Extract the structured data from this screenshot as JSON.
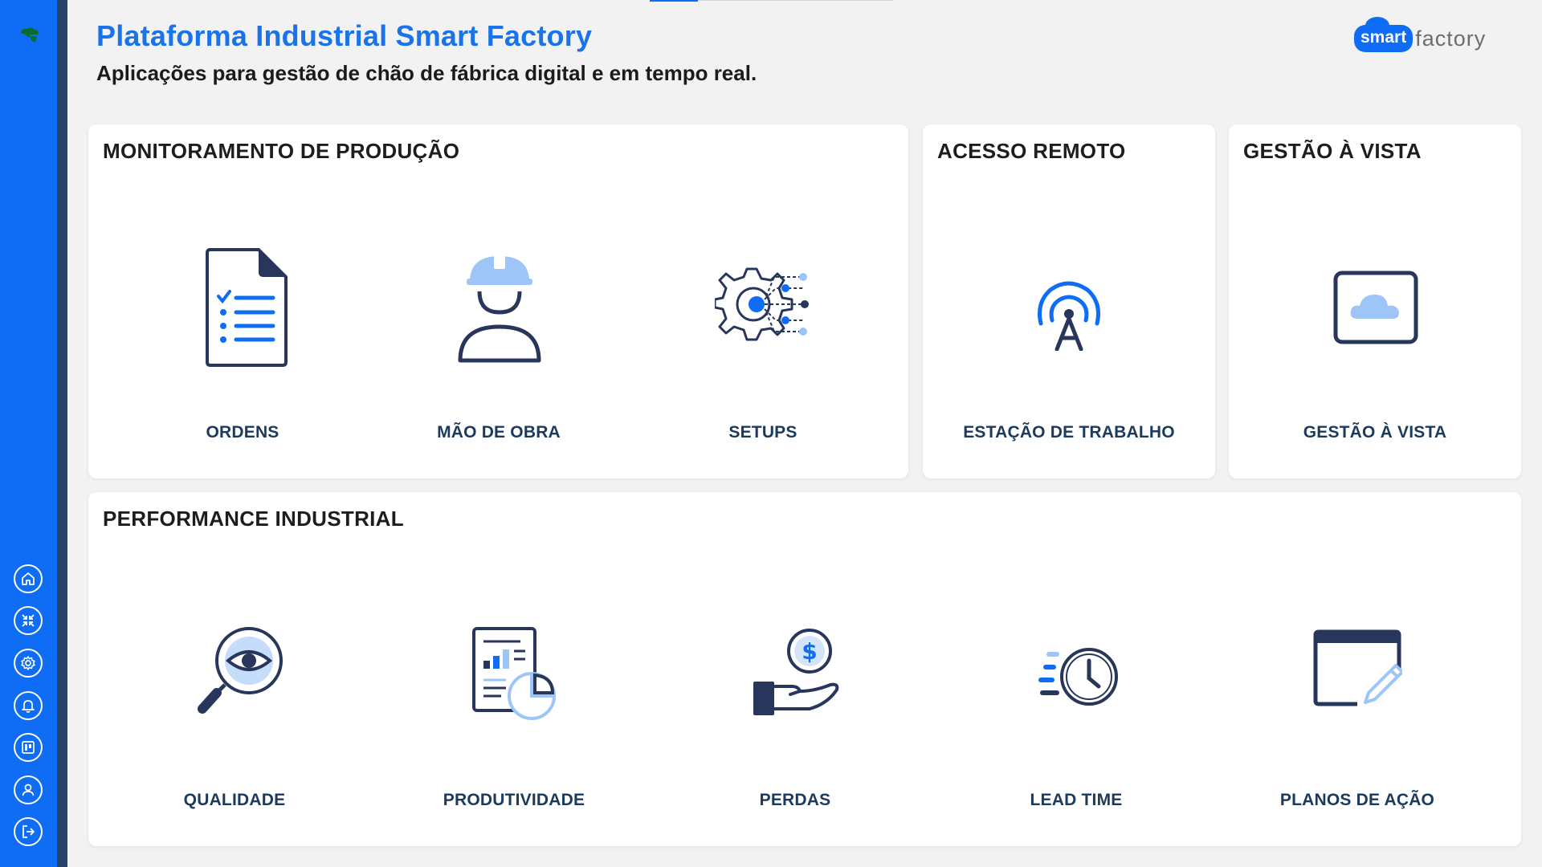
{
  "header": {
    "title": "Plataforma Industrial Smart Factory",
    "subtitle": "Aplicações para gestão de chão de fábrica digital e em tempo real."
  },
  "brand": {
    "pill": "smart",
    "text": "factory"
  },
  "colors": {
    "primary": "#0f6df5",
    "sidebar_edge": "#26416a",
    "label": "#1b3a5c",
    "icon_dark": "#27365a",
    "icon_light": "#9ec5f7"
  },
  "sidebar": {
    "items": [
      {
        "name": "home",
        "icon": "home-icon"
      },
      {
        "name": "fullscreen",
        "icon": "collapse-arrows-icon"
      },
      {
        "name": "settings",
        "icon": "gear-icon"
      },
      {
        "name": "notifications",
        "icon": "bell-icon"
      },
      {
        "name": "board",
        "icon": "kanban-icon"
      },
      {
        "name": "profile",
        "icon": "user-icon"
      },
      {
        "name": "logout",
        "icon": "logout-icon"
      }
    ]
  },
  "cards": {
    "monitoramento": {
      "title": "MONITORAMENTO DE PRODUÇÃO",
      "tiles": [
        {
          "label": "ORDENS",
          "icon": "document-checklist-icon"
        },
        {
          "label": "MÃO DE OBRA",
          "icon": "worker-helmet-icon"
        },
        {
          "label": "SETUPS",
          "icon": "gear-network-icon"
        }
      ]
    },
    "acesso": {
      "title": "ACESSO REMOTO",
      "tiles": [
        {
          "label": "ESTAÇÃO DE TRABALHO",
          "icon": "antenna-icon"
        }
      ]
    },
    "gestao": {
      "title": "GESTÃO À VISTA",
      "tiles": [
        {
          "label": "GESTÃO À VISTA",
          "icon": "cloud-screen-icon"
        }
      ]
    },
    "performance": {
      "title": "PERFORMANCE INDUSTRIAL",
      "tiles": [
        {
          "label": "QUALIDADE",
          "icon": "magnifier-eye-icon"
        },
        {
          "label": "PRODUTIVIDADE",
          "icon": "report-chart-icon"
        },
        {
          "label": "PERDAS",
          "icon": "hand-coin-icon"
        },
        {
          "label": "LEAD TIME",
          "icon": "fast-clock-icon"
        },
        {
          "label": "PLANOS DE AÇÃO",
          "icon": "window-pencil-icon"
        }
      ]
    }
  }
}
